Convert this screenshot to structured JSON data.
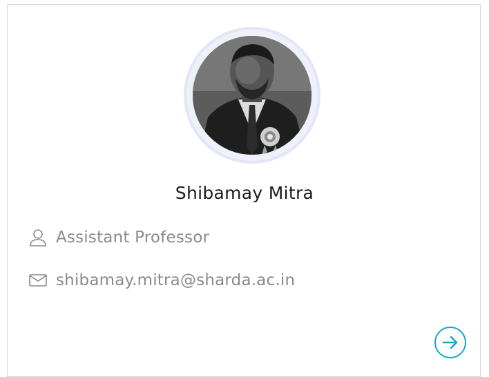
{
  "profile": {
    "name": "Shibamay Mitra",
    "designation": "Assistant Professor",
    "email": "shibamay.mitra@sharda.ac.in",
    "photo_alt": "Shibamay Mitra"
  },
  "icons": {
    "designation": "user-icon",
    "email": "mail-icon",
    "action": "arrow-right-icon"
  },
  "colors": {
    "accent": "#1aa6c9",
    "text_primary": "#1a1a1a",
    "text_secondary": "#8a8a8a",
    "ring": "#e3e6f6"
  }
}
